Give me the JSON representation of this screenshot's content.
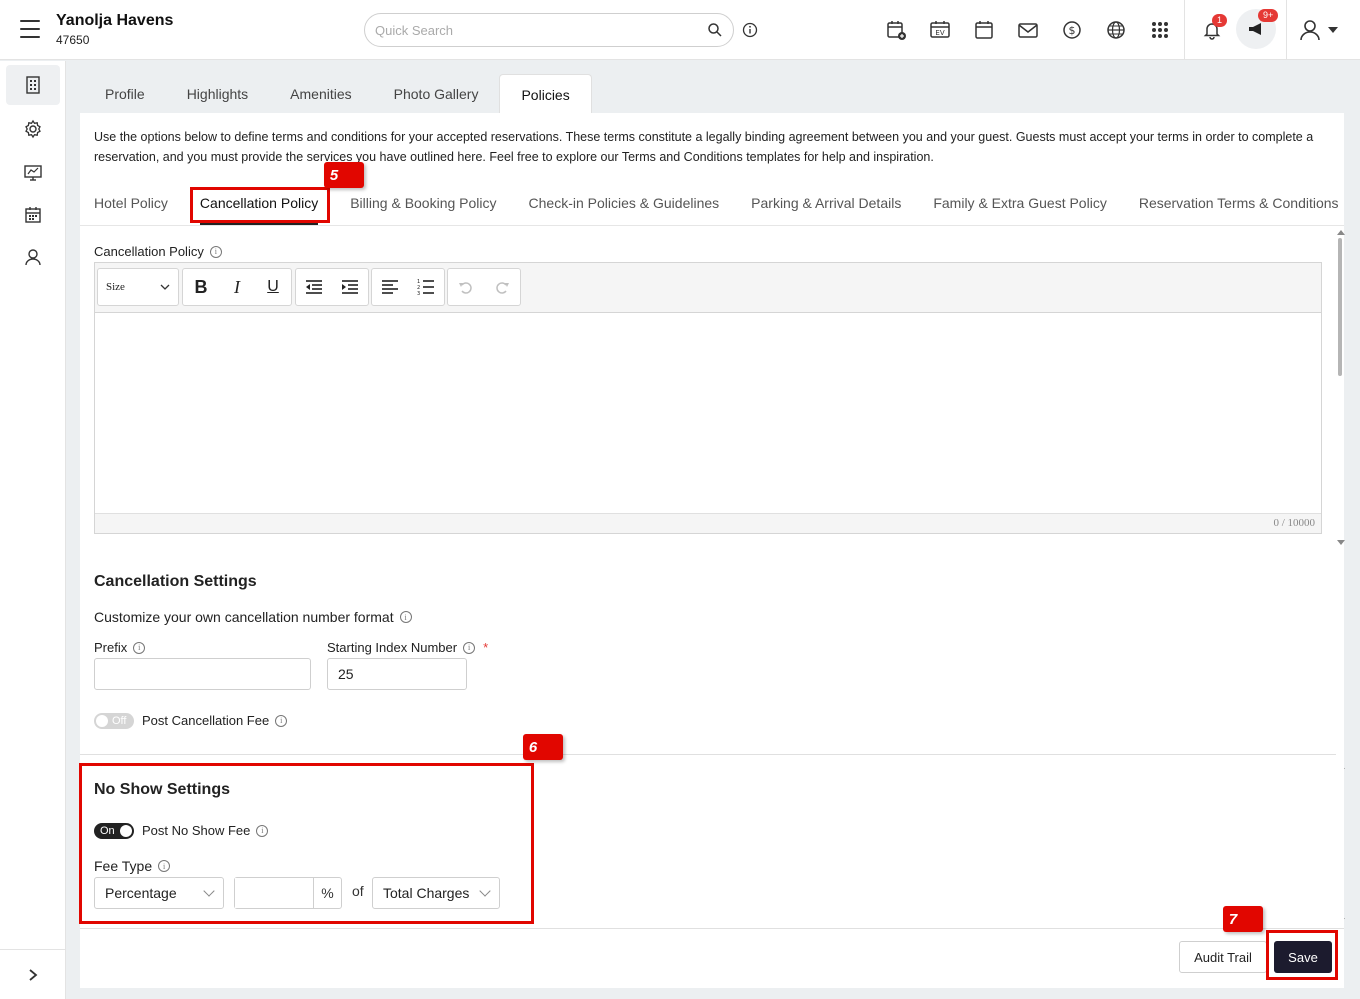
{
  "header": {
    "hotel_name": "Yanolja Havens",
    "hotel_id": "47650",
    "search_placeholder": "Quick Search",
    "notifications_count": "1",
    "announcements_count": "9+",
    "icons": [
      "calendar-add-icon",
      "ev-calendar-icon",
      "calendar-icon",
      "mail-icon",
      "dollar-icon",
      "globe-icon",
      "apps-grid-icon"
    ]
  },
  "sidebar": {
    "items": [
      "building-icon",
      "gear-icon",
      "monitor-icon",
      "calendar-grid-icon",
      "user-icon"
    ]
  },
  "main_tabs": [
    {
      "label": "Profile"
    },
    {
      "label": "Highlights"
    },
    {
      "label": "Amenities"
    },
    {
      "label": "Photo Gallery"
    },
    {
      "label": "Policies",
      "active": true
    }
  ],
  "intro": "Use the options below to define terms and conditions for your accepted reservations. These terms constitute a legally binding agreement between you and your guest. Guests must accept your terms in order to complete a reservation, and you must provide the services you have outlined here. Feel free to explore our Terms and Conditions templates for help and inspiration.",
  "sub_tabs": [
    {
      "label": "Hotel Policy"
    },
    {
      "label": "Cancellation Policy",
      "active": true
    },
    {
      "label": "Billing & Booking Policy"
    },
    {
      "label": "Check-in Policies & Guidelines"
    },
    {
      "label": "Parking & Arrival Details"
    },
    {
      "label": "Family & Extra Guest Policy"
    },
    {
      "label": "Reservation Terms & Conditions"
    }
  ],
  "editor": {
    "label": "Cancellation Policy",
    "size_label": "Size",
    "char_count": "0 / 10000"
  },
  "cancellation_settings": {
    "title": "Cancellation Settings",
    "subtitle": "Customize your own cancellation number format",
    "prefix_label": "Prefix",
    "prefix_value": "",
    "start_index_label": "Starting Index Number",
    "start_index_value": "25",
    "post_fee_toggle": "Off",
    "post_fee_label": "Post Cancellation Fee"
  },
  "no_show": {
    "title": "No Show Settings",
    "toggle": "On",
    "post_label": "Post No Show Fee",
    "fee_type_label": "Fee Type",
    "fee_type_value": "Percentage",
    "amount_value": "",
    "unit": "%",
    "of_label": "of",
    "basis_value": "Total Charges"
  },
  "footer": {
    "audit_label": "Audit Trail",
    "save_label": "Save"
  },
  "annotations": {
    "step5": "5",
    "step6": "6",
    "step7": "7"
  },
  "colors": {
    "highlight": "#e10600",
    "save_button": "#1c1b2e"
  }
}
